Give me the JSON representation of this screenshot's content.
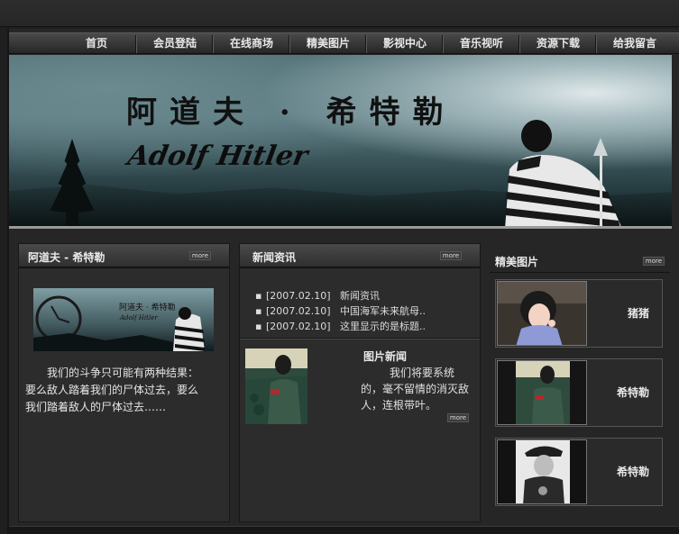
{
  "nav": {
    "items": [
      {
        "label": "首页"
      },
      {
        "label": "会员登陆"
      },
      {
        "label": "在线商场"
      },
      {
        "label": "精美图片"
      },
      {
        "label": "影视中心"
      },
      {
        "label": "音乐视听"
      },
      {
        "label": "资源下载"
      },
      {
        "label": "给我留言"
      }
    ]
  },
  "banner": {
    "title_cn": "阿道夫 · 希特勒",
    "title_en": "Adolf Hitler"
  },
  "intro": {
    "title": "阿道夫 - 希特勒",
    "more": "more",
    "text": "我们的斗争只可能有两种结果：要么敌人踏着我们的尸体过去，要么我们踏着敌人的尸体过去……"
  },
  "news": {
    "title": "新闻资讯",
    "more": "more",
    "items": [
      {
        "date": "[2007.02.10]",
        "headline": "新闻资讯"
      },
      {
        "date": "[2007.02.10]",
        "headline": "中国海军未来航母.."
      },
      {
        "date": "[2007.02.10]",
        "headline": "这里显示的是标题.."
      }
    ],
    "picture_news": {
      "title": "图片新闻",
      "text": "我们将要系统的，毫不留情的消灭敌人，连根带叶。",
      "more": "more"
    }
  },
  "gallery": {
    "title": "精美图片",
    "more": "more",
    "items": [
      {
        "name": "猪猪"
      },
      {
        "name": "希特勒"
      },
      {
        "name": "希特勒"
      }
    ]
  }
}
